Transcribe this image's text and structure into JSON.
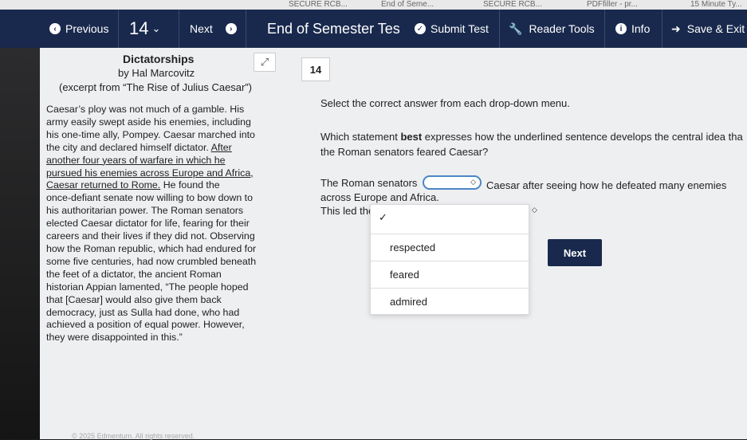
{
  "browser_tabs": [
    "SECURE RCB...",
    "End of Seme...",
    "SECURE RCB...",
    "PDFfiller - pr...",
    "15 Minute Ty..."
  ],
  "toolbar": {
    "previous": "Previous",
    "question_number": "14",
    "next": "Next",
    "title": "End of Semester Tes",
    "submit": "Submit Test",
    "reader_tools": "Reader Tools",
    "info": "Info",
    "save_exit": "Save & Exit"
  },
  "passage": {
    "title": "Dictatorships",
    "author": "by Hal Marcovitz",
    "source": "(excerpt from “The Rise of Julius Caesar”)",
    "lines": [
      "Caesar’s ploy was not much of a gamble. His",
      "army easily swept aside his enemies, including",
      "his one-time ally, Pompey. Caesar marched into",
      "the city and declared himself dictator.",
      "another four years of warfare in which he",
      "pursued his enemies across Europe and Africa,",
      "Caesar returned to Rome.",
      "He found the",
      "once-defiant senate now willing to bow down to",
      "his authoritarian power. The Roman senators",
      "elected Caesar dictator for life, fearing for their",
      "careers and their lives if they did not. Observing",
      "how the Roman republic, which had endured for",
      "some five centuries, had now crumbled beneath",
      "the feet of a dictator, the ancient Roman",
      "historian Appian lamented, “The people hoped",
      "that [Caesar] would also give them back",
      "democracy, just as Sulla had done, who had",
      "achieved a position of equal power. However,",
      "they were disappointed in this.”"
    ],
    "after": "After"
  },
  "question": {
    "number": "14",
    "instruction": "Select the correct answer from each drop-down menu.",
    "prompt_before": "Which statement ",
    "prompt_bold": "best",
    "prompt_after": " expresses how the underlined sentence develops the central idea tha",
    "prompt_line2": "the Roman senators feared Caesar?",
    "sentence1_before": "The Roman senators",
    "sentence1_after": "Caesar after seeing how he defeated many enemies",
    "sentence1_line2": "across Europe and Africa.",
    "sentence2_before": "This led the",
    "options": [
      "respected",
      "feared",
      "admired"
    ],
    "next_button": "Next"
  },
  "footer": "© 2025 Edmentum. All rights reserved."
}
